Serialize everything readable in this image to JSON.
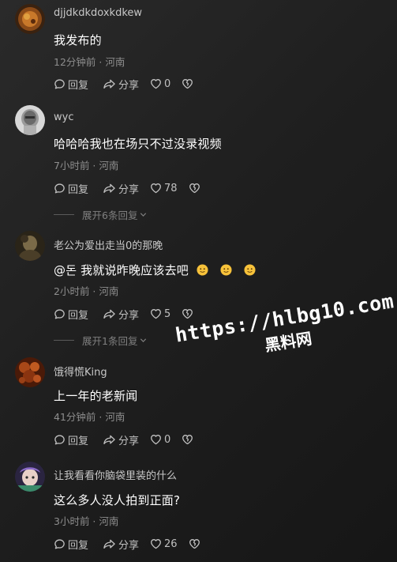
{
  "comments": [
    {
      "username": "djjdkdkdoxkdkew",
      "text": "我发布的",
      "time": "12分钟前",
      "location": "河南",
      "reply_label": "回复",
      "share_label": "分享",
      "likes": "0"
    },
    {
      "username": "wyc",
      "text": "哈哈哈我也在场只不过没录视频",
      "time": "7小时前",
      "location": "河南",
      "reply_label": "回复",
      "share_label": "分享",
      "likes": "78",
      "expand_label": "展开6条回复"
    },
    {
      "username": "老公为爱出走当0的那晚",
      "text": "@돈 我就说昨晚应该去吧",
      "emoji_count": 3,
      "time": "2小时前",
      "location": "河南",
      "reply_label": "回复",
      "share_label": "分享",
      "likes": "5",
      "expand_label": "展开1条回复"
    },
    {
      "username": "饿得慌King",
      "text": "上一年的老新闻",
      "time": "41分钟前",
      "location": "河南",
      "reply_label": "回复",
      "share_label": "分享",
      "likes": "0"
    },
    {
      "username": "让我看看你脑袋里装的什么",
      "text": "这么多人没人拍到正面?",
      "time": "3小时前",
      "location": "河南",
      "reply_label": "回复",
      "share_label": "分享",
      "likes": "26"
    }
  ],
  "meta_separator": " · ",
  "watermark": {
    "url": "https://hlbg10.com",
    "name": "黑料网"
  },
  "colors": {
    "background": "#1f1f1f",
    "text_primary": "#ffffff",
    "text_secondary": "#8e8e8e",
    "emoji": "#f7c23a"
  }
}
